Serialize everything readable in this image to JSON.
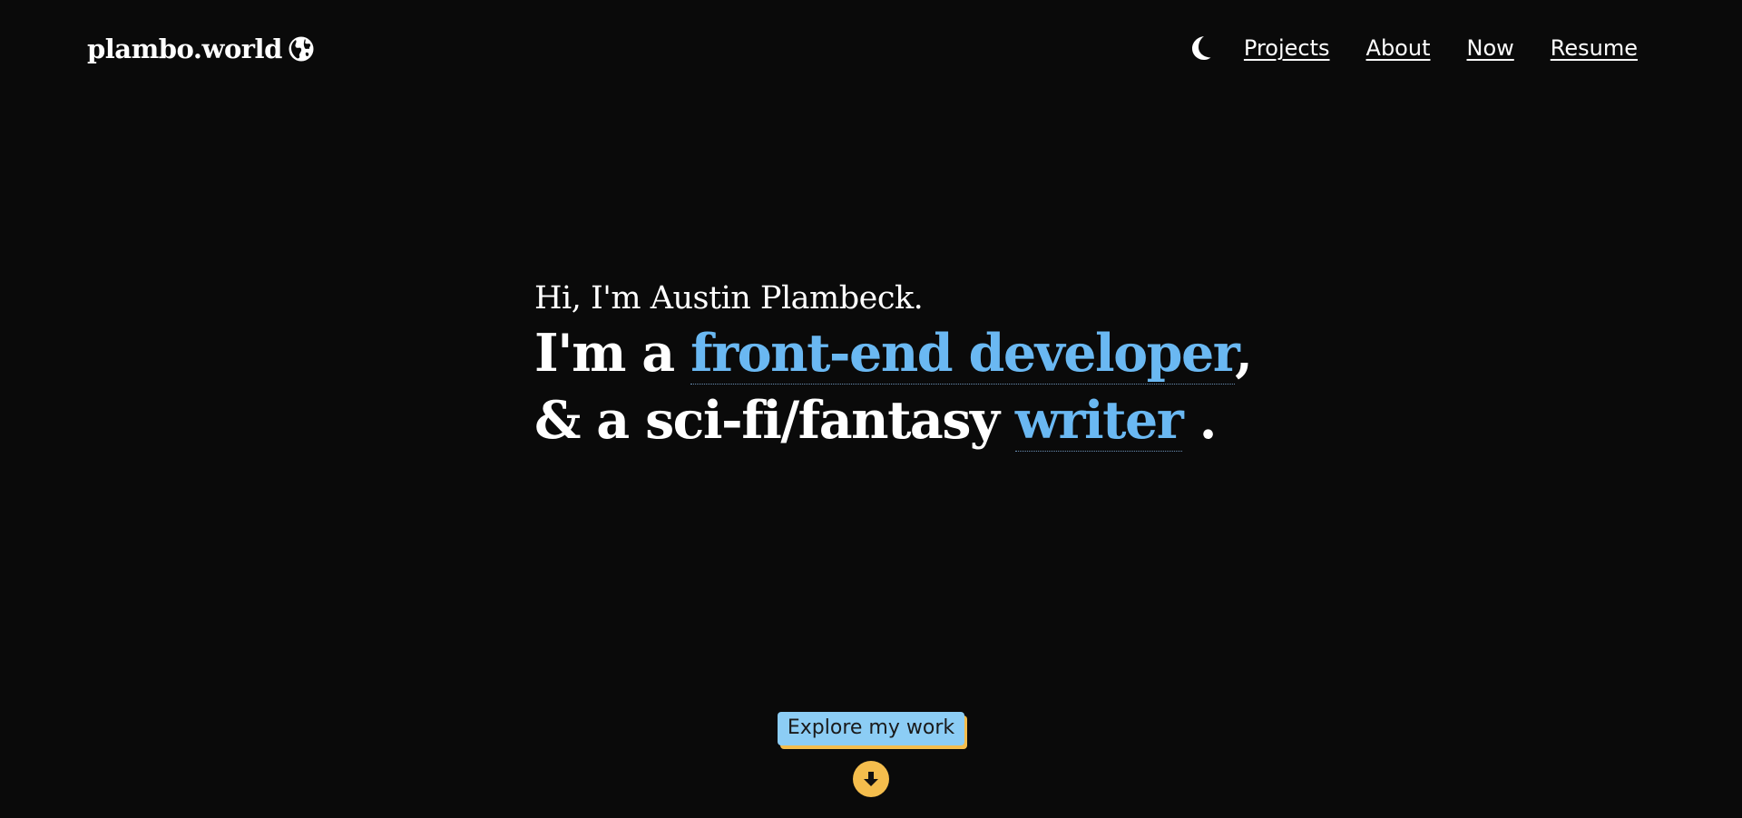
{
  "header": {
    "logo_text": "plambo.world",
    "logo_icon": "globe-icon",
    "theme_icon": "moon-icon",
    "nav": [
      {
        "label": "Projects"
      },
      {
        "label": "About"
      },
      {
        "label": "Now"
      },
      {
        "label": "Resume"
      }
    ]
  },
  "hero": {
    "greeting": "Hi, I'm Austin Plambeck.",
    "line1_prefix": "I'm a ",
    "line1_accent": "front-end developer",
    "line1_suffix": ",",
    "line2_prefix": "& a sci-fi/fantasy ",
    "line2_accent": "writer",
    "line2_suffix": " ."
  },
  "cta": {
    "label": "Explore my work",
    "arrow_icon": "arrow-down-icon"
  },
  "colors": {
    "background": "#0a0a0a",
    "text": "#ffffff",
    "accent_blue": "#6ab8f2",
    "button_bg": "#8ccdf5",
    "accent_yellow": "#f4bd4d"
  }
}
